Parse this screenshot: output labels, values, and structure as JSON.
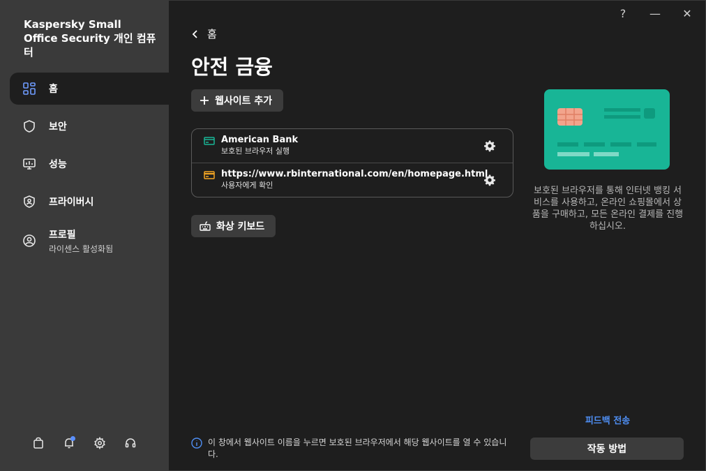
{
  "window": {
    "help": "?",
    "minimize": "—",
    "close": "✕"
  },
  "sidebar": {
    "app_title": "Kaspersky Small Office Security 개인 컴퓨터",
    "items": [
      {
        "label": "홈",
        "icon": "home-grid-icon",
        "active": true
      },
      {
        "label": "보안",
        "icon": "shield-icon"
      },
      {
        "label": "성능",
        "icon": "performance-monitor-icon"
      },
      {
        "label": "프라이버시",
        "icon": "privacy-shield-icon"
      },
      {
        "label": "프로필",
        "sublabel": "라이센스 활성화됨",
        "icon": "profile-icon"
      }
    ],
    "bottom_icons": [
      "store-bag-icon",
      "notification-bell-icon",
      "settings-gear-icon",
      "support-headset-icon"
    ]
  },
  "main": {
    "back_label": "홈",
    "title": "안전 금융",
    "add_site_label": "웹사이트 추가",
    "sites": [
      {
        "name": "American Bank",
        "description": "보호된 브라우저 실행",
        "icon_color": "#18b596"
      },
      {
        "name": "https://www.rbinternational.com/en/homepage.html",
        "description": "사용자에게 확인",
        "icon_color": "#f5a623"
      }
    ],
    "virtual_keyboard_label": "화상 키보드",
    "info_text": "이 창에서 웹사이트 이름을 누르면 보호된 브라우저에서 해당 웹사이트를 열 수 있습니다."
  },
  "right": {
    "promo_text": "보호된 브라우저를 통해 인터넷 뱅킹 서비스를 사용하고, 온라인 쇼핑몰에서 상품을 구매하고, 모든 온라인 결제를 진행하십시오.",
    "feedback_label": "피드백 전송",
    "howto_label": "작동 방법"
  },
  "colors": {
    "sidebar_bg": "#3a3a3a",
    "main_bg": "#1e1e1e",
    "accent": "#18b596",
    "link": "#4f8ff5",
    "warning": "#f5a623"
  }
}
